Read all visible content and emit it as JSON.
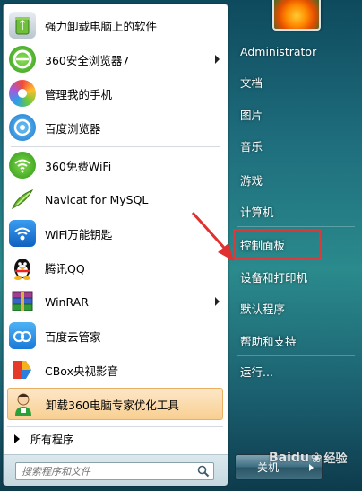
{
  "pinned": [
    {
      "label": "强力卸载电脑上的软件",
      "icon": "recycle-bin-icon"
    },
    {
      "label": "360安全浏览器7",
      "icon": "360-browser-icon",
      "submenu": true
    },
    {
      "label": "管理我的手机",
      "icon": "phone-manager-icon"
    },
    {
      "label": "百度浏览器",
      "icon": "baidu-browser-icon"
    }
  ],
  "recent": [
    {
      "label": "360免费WiFi",
      "icon": "wifi-360-icon"
    },
    {
      "label": "Navicat for MySQL",
      "icon": "navicat-icon"
    },
    {
      "label": "WiFi万能钥匙",
      "icon": "wifi-key-icon"
    },
    {
      "label": "腾讯QQ",
      "icon": "qq-penguin-icon"
    },
    {
      "label": "WinRAR",
      "icon": "winrar-icon",
      "submenu": true
    },
    {
      "label": "百度云管家",
      "icon": "baidu-cloud-icon"
    },
    {
      "label": "CBox央视影音",
      "icon": "cbox-icon"
    },
    {
      "label": "卸载360电脑专家优化工具",
      "icon": "uninstall-360-icon",
      "highlighted": true
    }
  ],
  "all_programs": "所有程序",
  "search": {
    "placeholder": "搜索程序和文件"
  },
  "right": {
    "user": "Administrator",
    "documents": "文档",
    "pictures": "图片",
    "music": "音乐",
    "games": "游戏",
    "computer": "计算机",
    "control_panel": "控制面板",
    "devices_printers": "设备和打印机",
    "default_programs": "默认程序",
    "help_support": "帮助和支持",
    "run": "运行..."
  },
  "shutdown": {
    "label": "关机"
  },
  "watermark": {
    "brand": "Baidu",
    "sub": "经验"
  },
  "colors": {
    "highlight_box": "#d93b3b",
    "annotation_arrow": "#e03030"
  }
}
